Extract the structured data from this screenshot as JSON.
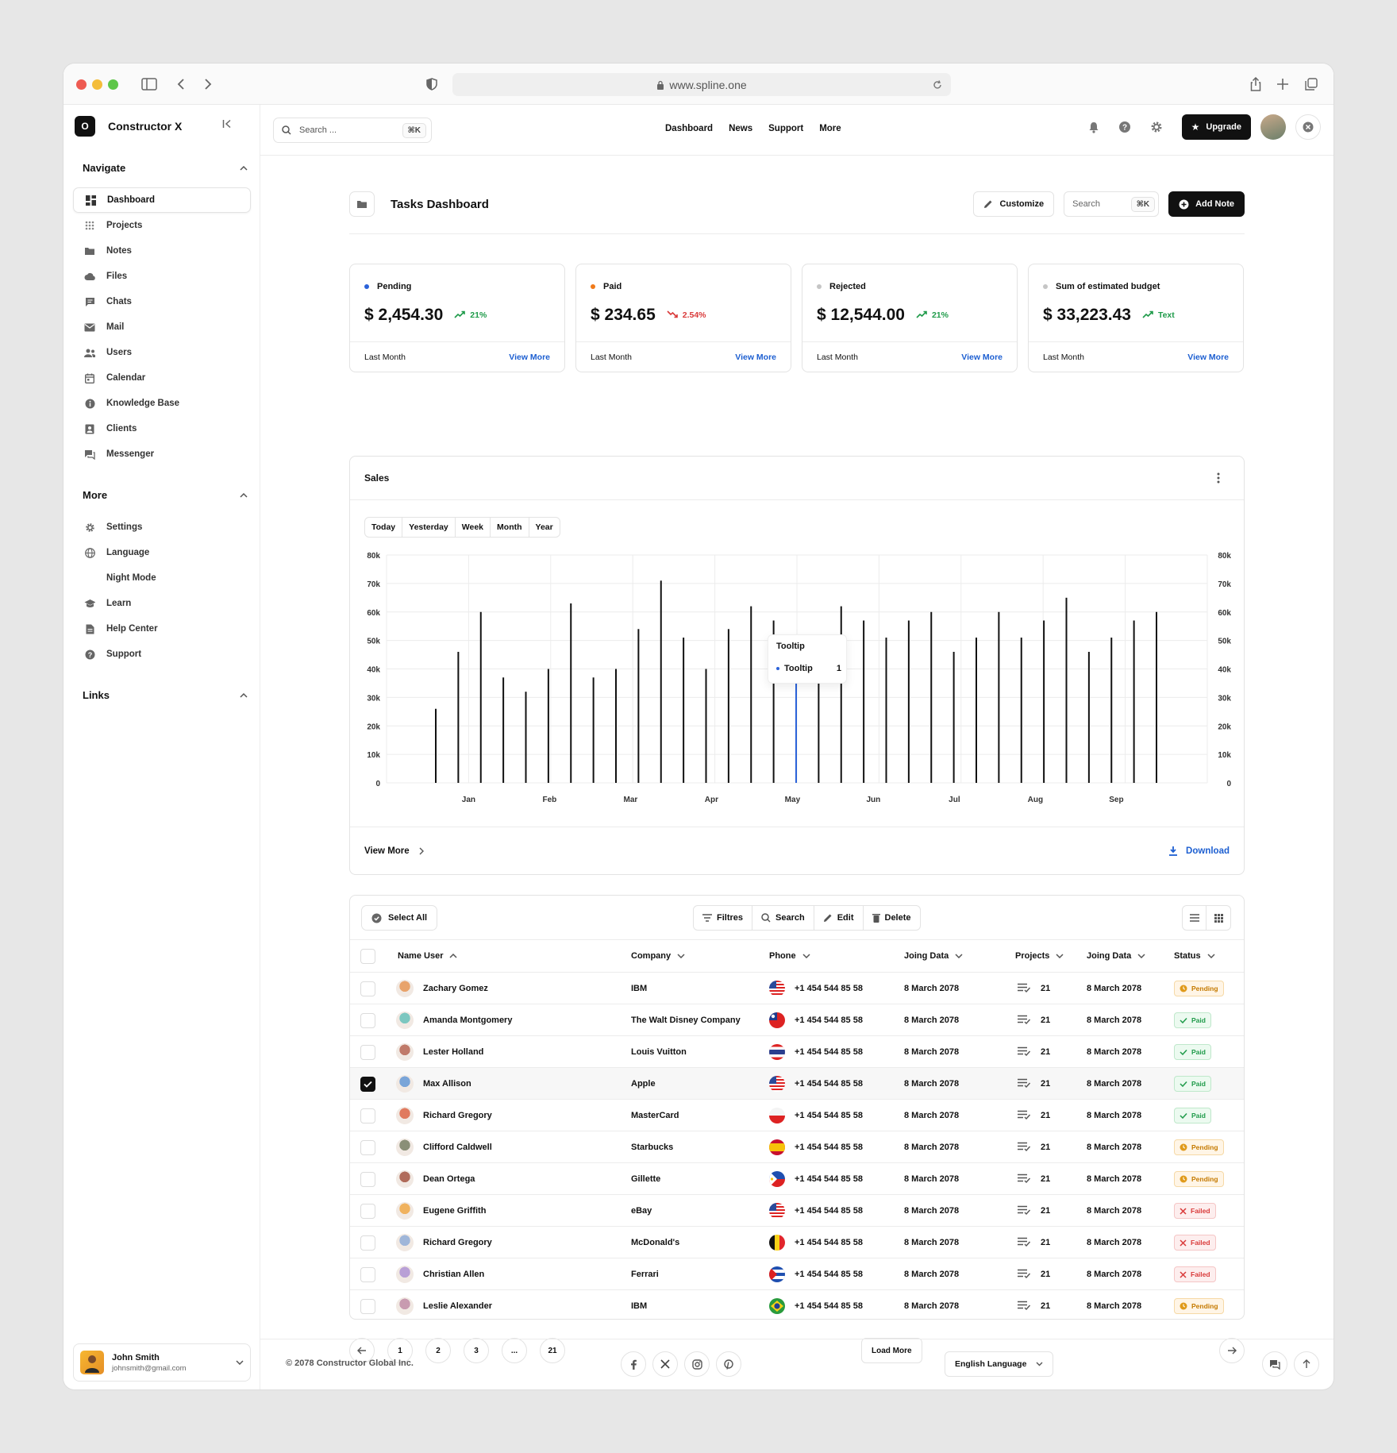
{
  "browser": {
    "url": "www.spline.one"
  },
  "brand": {
    "logo_letter": "O",
    "name": "Constructor X"
  },
  "sidebar": {
    "navigate_title": "Navigate",
    "navigate_items": [
      {
        "label": "Dashboard",
        "icon": "grid-icon",
        "active": true
      },
      {
        "label": "Projects",
        "icon": "dots-grid-icon"
      },
      {
        "label": "Notes",
        "icon": "folder-icon"
      },
      {
        "label": "Files",
        "icon": "cloud-icon"
      },
      {
        "label": "Chats",
        "icon": "chat-icon"
      },
      {
        "label": "Mail",
        "icon": "mail-icon"
      },
      {
        "label": "Users",
        "icon": "users-icon"
      },
      {
        "label": "Calendar",
        "icon": "calendar-icon"
      },
      {
        "label": "Knowledge Base",
        "icon": "info-icon"
      },
      {
        "label": "Clients",
        "icon": "contact-icon"
      },
      {
        "label": "Messenger",
        "icon": "messenger-icon"
      }
    ],
    "more_title": "More",
    "more_items": [
      {
        "label": "Settings",
        "icon": "gear-icon"
      },
      {
        "label": "Language",
        "icon": "globe-icon"
      },
      {
        "label": "Night Mode",
        "icon": "moon-icon"
      },
      {
        "label": "Learn",
        "icon": "graduation-cap-icon"
      },
      {
        "label": "Help Center",
        "icon": "document-icon"
      },
      {
        "label": "Support",
        "icon": "question-icon"
      }
    ],
    "links_title": "Links",
    "user": {
      "name": "John Smith",
      "email": "johnsmith@gmail.com"
    }
  },
  "topbar": {
    "search_placeholder": "Search ...",
    "search_kbd": "⌘K",
    "links": [
      "Dashboard",
      "News",
      "Support",
      "More"
    ],
    "upgrade_label": "Upgrade"
  },
  "page": {
    "title": "Tasks Dashboard",
    "customize_label": "Customize",
    "search_placeholder": "Search",
    "search_kbd": "⌘K",
    "add_note_label": "Add Note"
  },
  "stats": [
    {
      "label": "Pending",
      "dot": "#2b62d9",
      "value": "$ 2,454.30",
      "change": "21%",
      "trend": "up",
      "change_color": "#1f9b4a",
      "foot": "Last Month",
      "link": "View More"
    },
    {
      "label": "Paid",
      "dot": "#f07a1a",
      "value": "$ 234.65",
      "change": "2.54%",
      "trend": "down",
      "change_color": "#d93a3a",
      "foot": "Last Month",
      "link": "View More"
    },
    {
      "label": "Rejected",
      "dot": "#c5c5c5",
      "value": "$ 12,544.00",
      "change": "21%",
      "trend": "up",
      "change_color": "#1f9b4a",
      "foot": "Last Month",
      "link": "View More"
    },
    {
      "label": "Sum of estimated budget",
      "dot": "#c5c5c5",
      "value": "$ 33,223.43",
      "change": "Text",
      "trend": "up",
      "change_color": "#1f9b4a",
      "foot": "Last Month",
      "link": "View More"
    }
  ],
  "sales": {
    "title": "Sales",
    "ranges": [
      "Today",
      "Yesterday",
      "Week",
      "Month",
      "Year"
    ],
    "view_more": "View More",
    "download": "Download",
    "tooltip": {
      "title": "Tooltip",
      "label": "Tooltip",
      "value": "1"
    }
  },
  "chart_data": {
    "type": "bar",
    "title": "Sales",
    "xlabel": "",
    "ylabel": "",
    "x_tick_labels": [
      "Jan",
      "Feb",
      "Mar",
      "Apr",
      "May",
      "Jun",
      "Jul",
      "Aug",
      "Sep"
    ],
    "y_tick_labels": [
      "0",
      "10k",
      "20k",
      "30k",
      "40k",
      "50k",
      "60k",
      "70k",
      "80k"
    ],
    "ylim": [
      0,
      80000
    ],
    "grid": true,
    "values": [
      26000,
      46000,
      60000,
      37000,
      32000,
      40000,
      63000,
      37000,
      40000,
      54000,
      71000,
      51000,
      40000,
      54000,
      62000,
      57000,
      45000,
      41000,
      62000,
      57000,
      51000,
      57000,
      60000,
      46000,
      51000,
      60000,
      51000,
      57000,
      65000,
      46000,
      51000,
      57000,
      60000
    ],
    "highlight_index": 16,
    "highlight_color": "#2b62d9",
    "bar_color": "#111111"
  },
  "table": {
    "select_all": "Select All",
    "actions": [
      "Filtres",
      "Search",
      "Edit",
      "Delete"
    ],
    "columns": [
      "Name User",
      "Company",
      "Phone",
      "Joing Data",
      "Projects",
      "Joing Data",
      "Status"
    ],
    "rows": [
      {
        "name": "Zachary Gomez",
        "company": "IBM",
        "phone": "+1 454 544 85 58",
        "date": "8 March 2078",
        "projects": "21",
        "date2": "8 March 2078",
        "status": "Pending",
        "flag": "us",
        "checked": false
      },
      {
        "name": "Amanda Montgomery",
        "company": "The Walt Disney Company",
        "phone": "+1 454 544 85 58",
        "date": "8 March 2078",
        "projects": "21",
        "date2": "8 March 2078",
        "status": "Paid",
        "flag": "tw",
        "checked": false
      },
      {
        "name": "Lester Holland",
        "company": "Louis Vuitton",
        "phone": "+1 454 544 85 58",
        "date": "8 March 2078",
        "projects": "21",
        "date2": "8 March 2078",
        "status": "Paid",
        "flag": "th",
        "checked": false
      },
      {
        "name": "Max Allison",
        "company": "Apple",
        "phone": "+1 454 544 85 58",
        "date": "8 March 2078",
        "projects": "21",
        "date2": "8 March 2078",
        "status": "Paid",
        "flag": "us",
        "checked": true
      },
      {
        "name": "Richard Gregory",
        "company": "MasterCard",
        "phone": "+1 454 544 85 58",
        "date": "8 March 2078",
        "projects": "21",
        "date2": "8 March 2078",
        "status": "Paid",
        "flag": "pl",
        "checked": false
      },
      {
        "name": "Clifford Caldwell",
        "company": "Starbucks",
        "phone": "+1 454 544 85 58",
        "date": "8 March 2078",
        "projects": "21",
        "date2": "8 March 2078",
        "status": "Pending",
        "flag": "es",
        "checked": false
      },
      {
        "name": "Dean Ortega",
        "company": "Gillette",
        "phone": "+1 454 544 85 58",
        "date": "8 March 2078",
        "projects": "21",
        "date2": "8 March 2078",
        "status": "Pending",
        "flag": "ph",
        "checked": false
      },
      {
        "name": "Eugene Griffith",
        "company": "eBay",
        "phone": "+1 454 544 85 58",
        "date": "8 March 2078",
        "projects": "21",
        "date2": "8 March 2078",
        "status": "Failed",
        "flag": "us",
        "checked": false
      },
      {
        "name": "Richard Gregory",
        "company": "McDonald's",
        "phone": "+1 454 544 85 58",
        "date": "8 March 2078",
        "projects": "21",
        "date2": "8 March 2078",
        "status": "Failed",
        "flag": "be",
        "checked": false
      },
      {
        "name": "Christian Allen",
        "company": "Ferrari",
        "phone": "+1 454 544 85 58",
        "date": "8 March 2078",
        "projects": "21",
        "date2": "8 March 2078",
        "status": "Failed",
        "flag": "cu",
        "checked": false
      },
      {
        "name": "Leslie Alexander",
        "company": "IBM",
        "phone": "+1 454 544 85 58",
        "date": "8 March 2078",
        "projects": "21",
        "date2": "8 March 2078",
        "status": "Pending",
        "flag": "br",
        "checked": false
      }
    ]
  },
  "pagination": {
    "pages": [
      "1",
      "2",
      "3",
      "...",
      "21"
    ],
    "load_more": "Load More"
  },
  "footer": {
    "copyright": "© 2078 Constructor Global Inc.",
    "social": [
      "facebook-icon",
      "x-icon",
      "instagram-icon",
      "pinterest-icon"
    ],
    "language": "English Language"
  }
}
